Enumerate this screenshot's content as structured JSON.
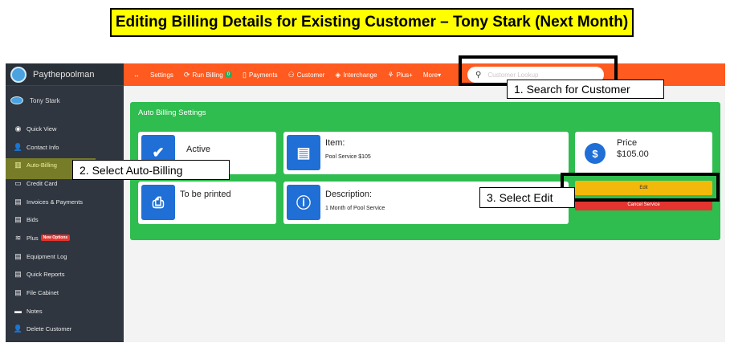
{
  "banner": {
    "title": "Editing Billing Details for Existing Customer – Tony Stark (Next Month)"
  },
  "app": {
    "brand": "Paythepoolman",
    "user": "Tony Stark",
    "sidebar": [
      {
        "label": "Quick View",
        "icon": "dashboard-icon",
        "glyph": "◉"
      },
      {
        "label": "Contact Info",
        "icon": "contact-icon",
        "glyph": "👤"
      },
      {
        "label": "Auto-Billing",
        "icon": "billing-icon",
        "glyph": "▥"
      },
      {
        "label": "Credit Card",
        "icon": "credit-card-icon",
        "glyph": "▭"
      },
      {
        "label": "Invoices & Payments",
        "icon": "invoice-icon",
        "glyph": "▤"
      },
      {
        "label": "Bids",
        "icon": "bids-icon",
        "glyph": "▤"
      },
      {
        "label": "Plus",
        "icon": "plus-icon",
        "glyph": "≋",
        "badge": "New Options"
      },
      {
        "label": "Equipment Log",
        "icon": "clipboard-icon",
        "glyph": "▤"
      },
      {
        "label": "Quick Reports",
        "icon": "reports-icon",
        "glyph": "▤"
      },
      {
        "label": "File Cabinet",
        "icon": "file-cabinet-icon",
        "glyph": "▤"
      },
      {
        "label": "Notes",
        "icon": "notes-icon",
        "glyph": "▬"
      },
      {
        "label": "Delete Customer",
        "icon": "delete-user-icon",
        "glyph": "👤"
      }
    ],
    "topbar": {
      "arrows_glyph": "↔",
      "settings": "Settings",
      "run_billing": "Run Billing",
      "run_billing_badge": "0",
      "payments": "Payments",
      "customer": "Customer",
      "interchange": "Interchange",
      "plus": "Plus+",
      "more": "More▾",
      "search_placeholder": "Customer Lookup"
    },
    "panel": {
      "title": "Auto Billing Settings",
      "status": "Active",
      "item_label": "Item:",
      "item_value": "Pool Service $105",
      "price_label": "Price",
      "price_value": "$105.00",
      "print_status": "To be printed",
      "description_label": "Description:",
      "description_value": "1 Month of Pool Service",
      "edit_button": "Edit",
      "cancel_button": "Cancel Service"
    }
  },
  "callouts": {
    "search": "1. Search for Customer",
    "auto_billing": "2. Select Auto-Billing",
    "edit": "3. Select Edit"
  },
  "colors": {
    "accent_orange": "#ff5a1f",
    "panel_green": "#2ebd4e",
    "icon_blue": "#1f6fd6",
    "edit_yellow": "#f2b90b",
    "cancel_red": "#e3342f",
    "sidebar_dark": "#2f3640",
    "highlight_yellow": "#ffff00"
  }
}
